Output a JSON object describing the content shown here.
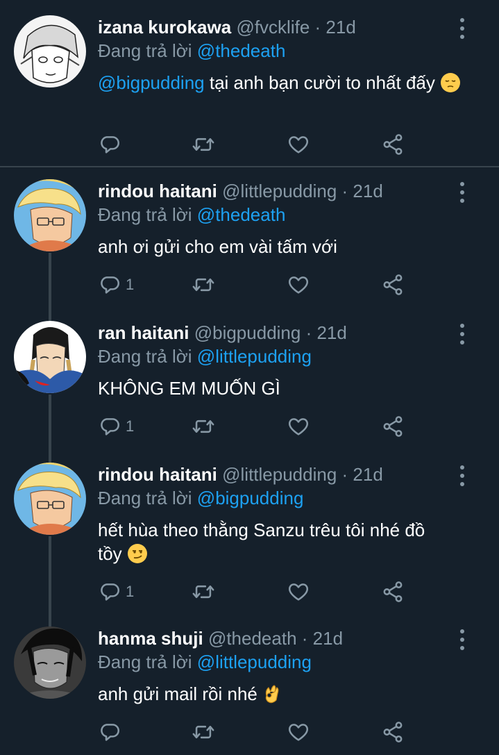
{
  "tweets": [
    {
      "name": "izana kurokawa",
      "handle": "@fvcklife",
      "time": "· 21d",
      "reply_prefix": "Đang trả lời",
      "reply_to": "@thedeath",
      "mention": "@bigpudding",
      "text": " tại anh bạn cười to nhất đấy",
      "emoji": "pensive-face",
      "reply_count": ""
    },
    {
      "name": "rindou haitani",
      "handle": "@littlepudding",
      "time": "· 21d",
      "reply_prefix": "Đang trả lời",
      "reply_to": "@thedeath",
      "text": "anh ơi gửi cho em vài tấm với",
      "reply_count": "1"
    },
    {
      "name": "ran haitani",
      "handle": "@bigpudding",
      "time": "· 21d",
      "reply_prefix": "Đang trả lời",
      "reply_to": "@littlepudding",
      "text": "KHÔNG EM MUỐN GÌ",
      "reply_count": "1"
    },
    {
      "name": "rindou haitani",
      "handle": "@littlepudding",
      "time": "· 21d",
      "reply_prefix": "Đang trả lời",
      "reply_to": "@bigpudding",
      "text": "hết hùa theo thằng Sanzu trêu tôi nhé đồ tồy",
      "emoji": "smirking-face",
      "reply_count": "1"
    },
    {
      "name": "hanma shuji",
      "handle": "@thedeath",
      "time": "· 21d",
      "reply_prefix": "Đang trả lời",
      "reply_to": "@littlepudding",
      "text": "anh gửi mail rồi nhé",
      "emoji": "ok-hand",
      "reply_count": ""
    }
  ],
  "colors": {
    "background": "#15202b",
    "text_primary": "#ffffff",
    "text_secondary": "#8899a6",
    "accent": "#1da1f2",
    "divider": "#38444d"
  },
  "icons": [
    "reply-icon",
    "retweet-icon",
    "like-icon",
    "share-icon",
    "more-icon"
  ]
}
